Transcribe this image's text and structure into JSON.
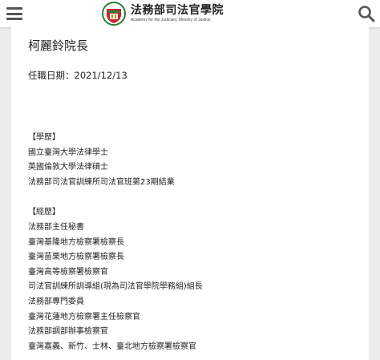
{
  "header": {
    "logo_name_zh": "法務部司法官學院",
    "logo_name_en": "Academy for the Judiciary, Ministry of Justice",
    "menu_icon": "hamburger-menu-icon",
    "search_icon": "search-icon",
    "emblem_colors": {
      "red": "#c8252c",
      "green": "#2e7d3a",
      "gold": "#b8912b"
    }
  },
  "profile": {
    "name": "柯麗鈴院長",
    "term_date": "任職日期：2021/12/13",
    "education_heading": "【學歷】",
    "education": [
      "國立臺灣大學法律學士",
      "英國倫敦大學法律碩士",
      "法務部司法官訓練所司法官班第23期結業"
    ],
    "experience_heading": "【經歷】",
    "experience": [
      "法務部主任秘書",
      "臺灣基隆地方檢察署檢察長",
      "臺灣苗栗地方檢察署檢察長",
      "臺灣高等檢察署檢察官",
      "司法官訓練所訓導組(現為司法官學院學務組)組長",
      "法務部專門委員",
      "臺灣花蓮地方檢察署主任檢察官",
      "法務部調部辦事檢察官",
      "臺灣嘉義、新竹、士林、臺北地方檢察署檢察官"
    ]
  }
}
